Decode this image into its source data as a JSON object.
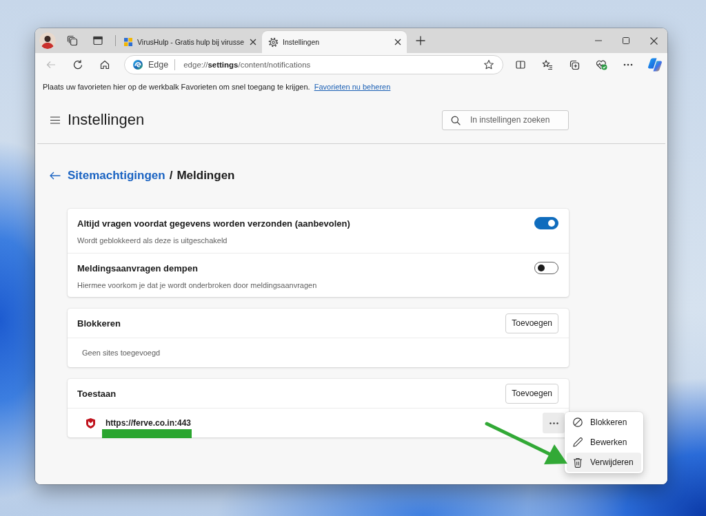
{
  "tabs": [
    {
      "title": "VirusHulp - Gratis hulp bij virusse",
      "kind": "page",
      "selected": false
    },
    {
      "title": "Instellingen",
      "kind": "settings",
      "selected": true
    }
  ],
  "back_button": {
    "disabled": true
  },
  "address_bar": {
    "label": "Edge",
    "url": "edge://**settings**/content/notifications"
  },
  "favorites_bar": {
    "text": "Plaats uw favorieten hier op de werkbalk Favorieten om snel toegang te krijgen.",
    "link": "Favorieten nu beheren"
  },
  "header": {
    "title": "Instellingen",
    "search_placeholder": "In instellingen zoeken"
  },
  "breadcrumb": {
    "parent": "Sitemachtigingen",
    "separator": "/",
    "current": "Meldingen"
  },
  "settings": [
    {
      "title": "Altijd vragen voordat gegevens worden verzonden (aanbevolen)",
      "description": "Wordt geblokkeerd als deze is uitgeschakeld",
      "on": true
    },
    {
      "title": "Meldingsaanvragen dempen",
      "description": "Hiermee voorkom je dat je wordt onderbroken door meldingsaanvragen",
      "on": false
    }
  ],
  "sections": [
    {
      "title": "Blokkeren",
      "button": "Toevoegen",
      "empty_text": "Geen sites toegevoegd"
    },
    {
      "title": "Toestaan",
      "button": "Toevoegen",
      "sites": [
        {
          "url": "https://ferve.co.in:443",
          "underlined": true,
          "menu_open": true
        }
      ]
    }
  ],
  "context_menu": {
    "items": [
      {
        "label": "Blokkeren",
        "kind": "block",
        "hovered": false,
        "arrow": false
      },
      {
        "label": "Bewerken",
        "kind": "edit",
        "hovered": false,
        "arrow": false
      },
      {
        "label": "Verwijderen",
        "kind": "delete",
        "hovered": true,
        "arrow": true
      }
    ]
  }
}
